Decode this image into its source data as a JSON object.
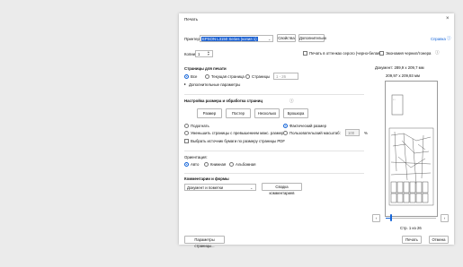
{
  "title": "Печать",
  "printer": {
    "label": "Принтер:",
    "value": "EPSON L3150 Series (копия 1)",
    "properties": "Свойства",
    "advanced": "Дополнительно",
    "help": "Справка"
  },
  "copies": {
    "label": "Копии:",
    "value": "1"
  },
  "options": {
    "grayscale": "Печать в оттенках серого (черно-белая)",
    "ink_save": "Экономия чернил/тонера"
  },
  "pages": {
    "heading": "Страницы для печати",
    "all": "Все",
    "current": "Текущая страница",
    "range": "Страницы",
    "range_value": "1 - 26",
    "more": "Дополнительные параметры"
  },
  "sizing": {
    "heading": "Настройка размера и обработка страниц",
    "buttons": [
      "Размер",
      "Постер",
      "Несколько",
      "Брошюра"
    ],
    "fit": "Подогнать",
    "actual": "Фактический размер",
    "shrink": "Уменьшить страницы с превышением макс. размера",
    "custom": "Пользовательский масштаб:",
    "custom_value": "100",
    "percent": "%",
    "pdf_source": "Выбрать источник бумаги по размеру страницы PDF"
  },
  "orientation": {
    "heading": "Ориентация:",
    "auto": "Авто",
    "portrait": "Книжная",
    "landscape": "Альбомная"
  },
  "comments": {
    "heading": "Комментарии и формы",
    "value": "Документ и пометки",
    "summary": "Сводка комментариев"
  },
  "preview": {
    "doc_size": "Документ: 289,9 x 209,7 мм",
    "paper_size": "209,97 x 209,93 мм",
    "page_info": "Стр. 1 из 26",
    "slider_position": 0.1
  },
  "footer": {
    "page_setup": "Параметры страницы...",
    "print": "Печать",
    "cancel": "Отмена"
  }
}
